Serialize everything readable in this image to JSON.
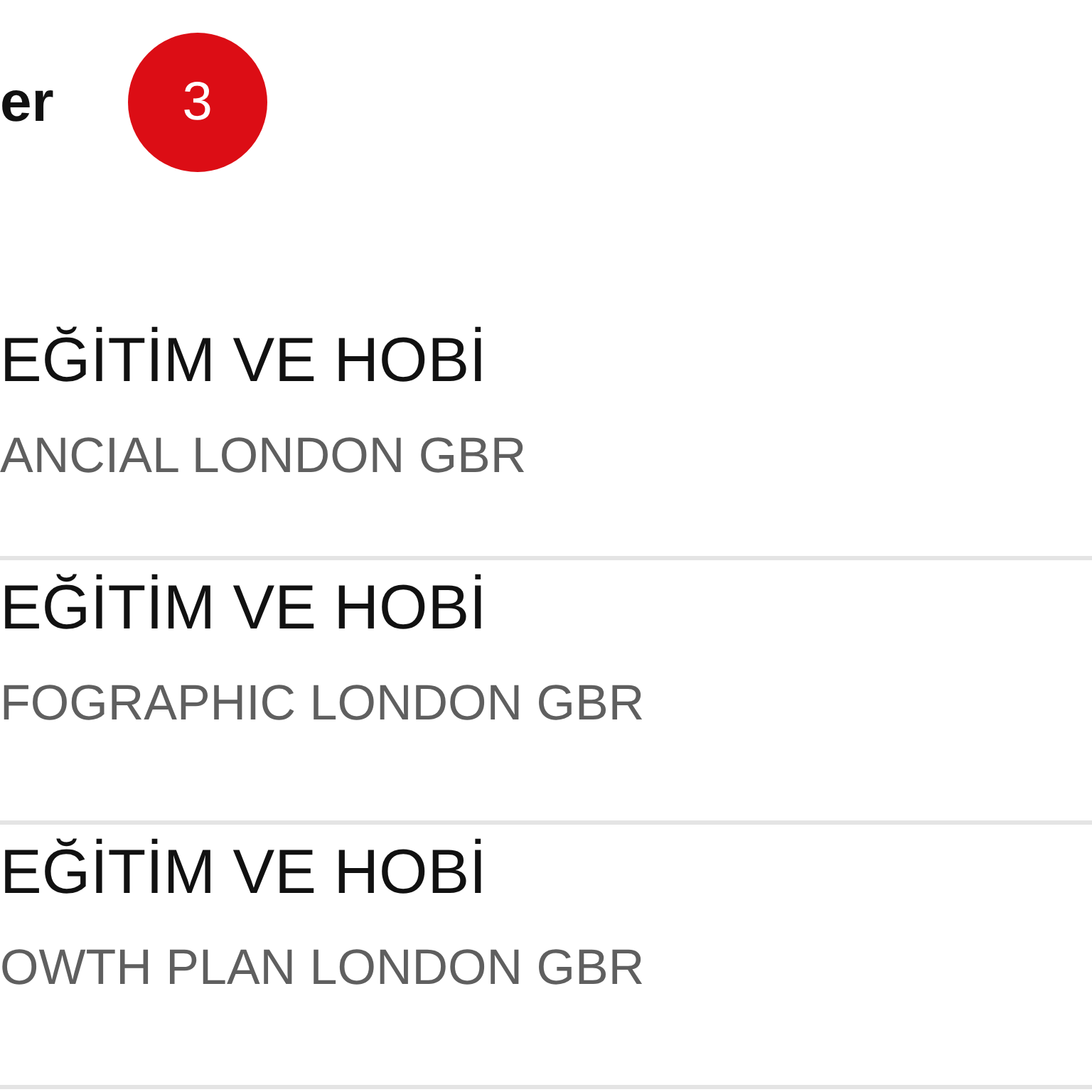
{
  "header": {
    "title": "er",
    "badge": "3"
  },
  "items": [
    {
      "title": "EĞİTİM VE HOBİ",
      "subtitle": "ANCIAL LONDON GBR"
    },
    {
      "title": "EĞİTİM VE HOBİ",
      "subtitle": "FOGRAPHIC LONDON GBR"
    },
    {
      "title": "EĞİTİM VE HOBİ",
      "subtitle": "OWTH PLAN LONDON GBR"
    }
  ]
}
